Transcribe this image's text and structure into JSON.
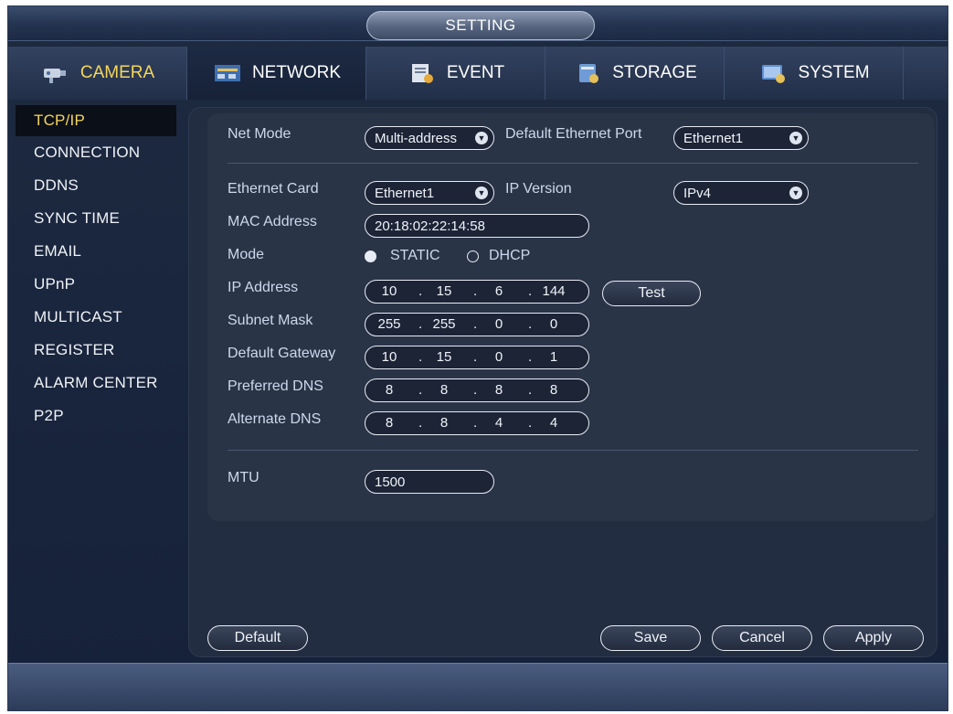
{
  "window": {
    "title": "SETTING"
  },
  "tabs": [
    {
      "label": "CAMERA",
      "icon": "camera-icon"
    },
    {
      "label": "NETWORK",
      "icon": "network-icon"
    },
    {
      "label": "EVENT",
      "icon": "event-icon"
    },
    {
      "label": "STORAGE",
      "icon": "storage-icon"
    },
    {
      "label": "SYSTEM",
      "icon": "system-icon"
    }
  ],
  "sidebar": {
    "items": [
      {
        "label": "TCP/IP"
      },
      {
        "label": "CONNECTION"
      },
      {
        "label": "DDNS"
      },
      {
        "label": "SYNC TIME"
      },
      {
        "label": "EMAIL"
      },
      {
        "label": "UPnP"
      },
      {
        "label": "MULTICAST"
      },
      {
        "label": "REGISTER"
      },
      {
        "label": "ALARM CENTER"
      },
      {
        "label": "P2P"
      }
    ]
  },
  "form": {
    "net_mode": {
      "label": "Net Mode",
      "value": "Multi-address"
    },
    "default_port": {
      "label": "Default Ethernet Port",
      "value": "Ethernet1"
    },
    "ethernet_card": {
      "label": "Ethernet Card",
      "value": "Ethernet1"
    },
    "ip_version": {
      "label": "IP Version",
      "value": "IPv4"
    },
    "mac": {
      "label": "MAC Address",
      "value": "20:18:02:22:14:58"
    },
    "mode": {
      "label": "Mode",
      "static": "STATIC",
      "dhcp": "DHCP"
    },
    "ip_address": {
      "label": "IP Address",
      "octets": [
        "10",
        "15",
        "6",
        "144"
      ],
      "test": "Test"
    },
    "subnet": {
      "label": "Subnet Mask",
      "octets": [
        "255",
        "255",
        "0",
        "0"
      ]
    },
    "gateway": {
      "label": "Default Gateway",
      "octets": [
        "10",
        "15",
        "0",
        "1"
      ]
    },
    "pref_dns": {
      "label": "Preferred DNS",
      "octets": [
        "8",
        "8",
        "8",
        "8"
      ]
    },
    "alt_dns": {
      "label": "Alternate DNS",
      "octets": [
        "8",
        "8",
        "4",
        "4"
      ]
    },
    "mtu": {
      "label": "MTU",
      "value": "1500"
    }
  },
  "buttons": {
    "default": "Default",
    "save": "Save",
    "cancel": "Cancel",
    "apply": "Apply"
  },
  "colors": {
    "accent": "#f5d65a",
    "panel": "#232d41",
    "background": "#16213a"
  }
}
